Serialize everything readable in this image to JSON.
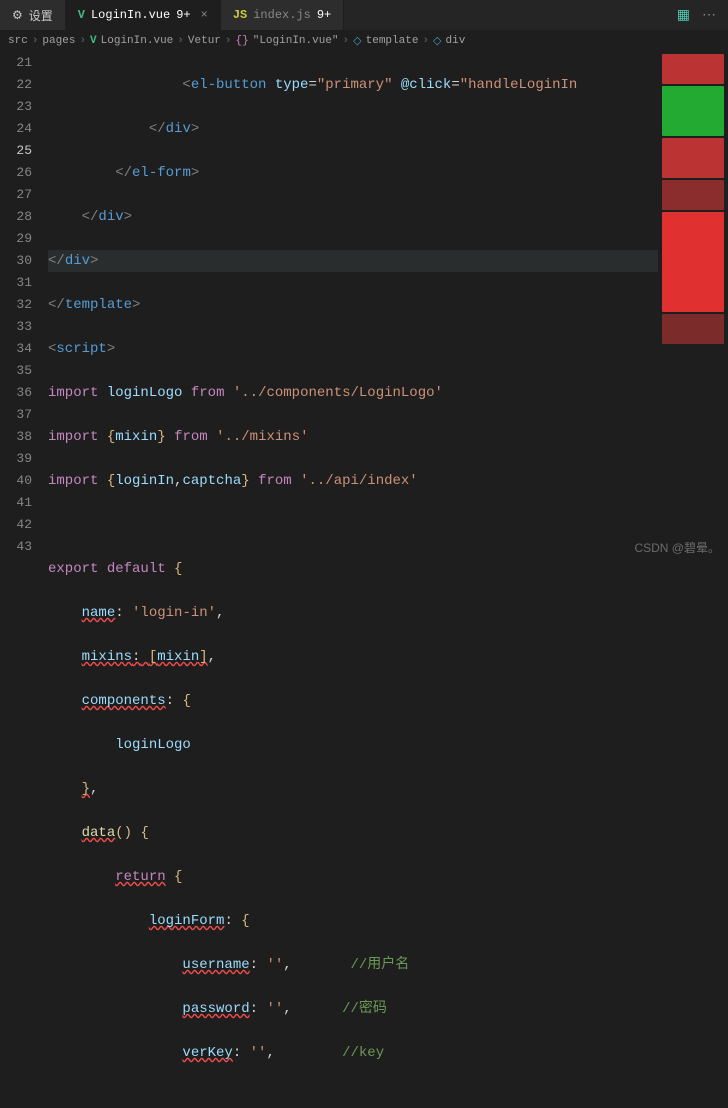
{
  "tabs": {
    "settings": "设置",
    "file1": {
      "name": "LoginIn.vue",
      "modified": "9+"
    },
    "file2": {
      "name": "index.js",
      "modified": "9+"
    }
  },
  "breadcrumbs": {
    "items": [
      "src",
      "pages",
      "LoginIn.vue",
      "Vetur",
      "\"LoginIn.vue\"",
      "template",
      "div"
    ]
  },
  "lines": {
    "l21": {
      "n": "21"
    },
    "l22": {
      "n": "22"
    },
    "l23": {
      "n": "23"
    },
    "l24": {
      "n": "24"
    },
    "l25": {
      "n": "25"
    },
    "l26": {
      "n": "26"
    },
    "l27": {
      "n": "27"
    },
    "l28": {
      "n": "28"
    },
    "l29": {
      "n": "29"
    },
    "l30": {
      "n": "30"
    },
    "l31": {
      "n": "31"
    },
    "l32": {
      "n": "32"
    },
    "l33": {
      "n": "33"
    },
    "l34": {
      "n": "34"
    },
    "l35": {
      "n": "35"
    },
    "l36": {
      "n": "36"
    },
    "l37": {
      "n": "37"
    },
    "l38": {
      "n": "38"
    },
    "l39": {
      "n": "39"
    },
    "l40": {
      "n": "40"
    },
    "l41": {
      "n": "41"
    },
    "l42": {
      "n": "42"
    },
    "l43": {
      "n": "43"
    }
  },
  "code": {
    "elbutton_lt": "<",
    "elbutton_tag": "el-button",
    "elbutton_attr1": " type",
    "elbutton_eq": "=",
    "elbutton_val1": "\"primary\"",
    "elbutton_attr2": " @click",
    "elbutton_val2": "\"handleLoginIn",
    "div_c1": "</",
    "div_c2": "div",
    "div_c3": ">",
    "elform_c1": "</",
    "elform_c2": "el-form",
    "elform_c3": ">",
    "template_c1": "</",
    "template_c2": "template",
    "template_c3": ">",
    "script_o1": "<",
    "script_o2": "script",
    "script_o3": ">",
    "import": "import",
    "from": "from",
    "loginLogo": "loginLogo",
    "loginLogoPath": "'../components/LoginLogo'",
    "lb": "{",
    "rb": "}",
    "mixin": "mixin",
    "mixinsPath": "'../mixins'",
    "loginIn": "loginIn",
    "comma": ",",
    "captcha": "captcha",
    "apiPath": "'../api/index'",
    "export": "export",
    "default": "default",
    "name_k": "name",
    "colon": ":",
    "name_v": "'login-in'",
    "mixins_k": "mixins",
    "lbracket": "[",
    "rbracket": "]",
    "components_k": "components",
    "data_k": "data",
    "parens": "()",
    "return": "return",
    "loginForm_k": "loginForm",
    "username_k": "username",
    "empty": "''",
    "password_k": "password",
    "verKey_k": "verKey",
    "c_user": "//用户名",
    "c_pass": "//密码",
    "c_key": "//key"
  },
  "watermark": "CSDN @碧晕。"
}
